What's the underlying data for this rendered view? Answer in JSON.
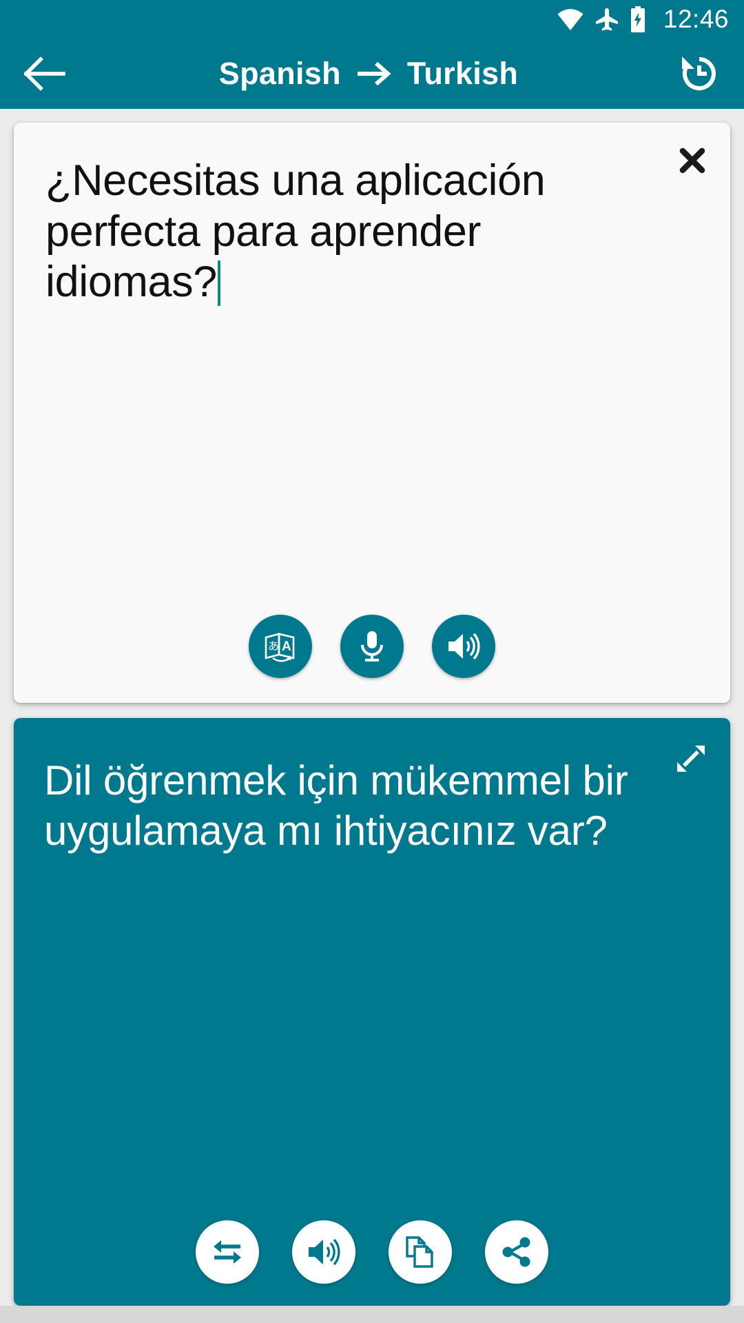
{
  "status_bar": {
    "time": "12:46",
    "icons": [
      "wifi-icon",
      "airplane-mode-icon",
      "battery-charging-icon"
    ]
  },
  "app_bar": {
    "back_icon": "back-arrow-icon",
    "source_language": "Spanish",
    "direction_icon": "right-arrow-icon",
    "target_language": "Turkish",
    "history_icon": "history-icon"
  },
  "source_card": {
    "text": "¿Necesitas una aplicación perfecta para aprender idiomas?",
    "close_icon": "close-icon",
    "caret_color": "#13887f",
    "background": "#f9f9f9",
    "actions": [
      {
        "name": "translate-button",
        "icon": "translate-icon"
      },
      {
        "name": "voice-input-button",
        "icon": "microphone-icon"
      },
      {
        "name": "speak-source-button",
        "icon": "speaker-icon"
      }
    ]
  },
  "target_card": {
    "text": "Dil öğrenmek için mükemmel bir uygulamaya mı ihtiyacınız var?",
    "expand_icon": "expand-icon",
    "background": "#00798f",
    "actions": [
      {
        "name": "swap-languages-button",
        "icon": "swap-arrows-icon"
      },
      {
        "name": "speak-translation-button",
        "icon": "speaker-icon"
      },
      {
        "name": "copy-translation-button",
        "icon": "copy-icon"
      },
      {
        "name": "share-translation-button",
        "icon": "share-icon"
      }
    ]
  },
  "theme": {
    "accent": "#00798f",
    "page_background": "#ececed",
    "nav_bar": "#d7d7d7"
  }
}
